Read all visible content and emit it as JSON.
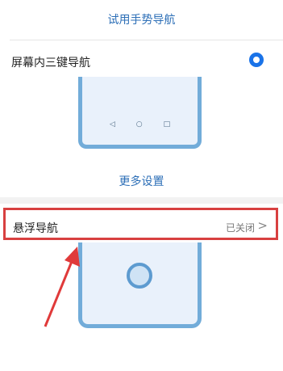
{
  "gesture_link": "试用手势导航",
  "three_key_nav": {
    "label": "屏幕内三键导航",
    "selected": true
  },
  "nav_icons": {
    "back": "◁",
    "home": "○",
    "recent": "□"
  },
  "more_settings": "更多设置",
  "floating_nav": {
    "label": "悬浮导航",
    "status": "已关闭",
    "chevron": ">"
  },
  "colors": {
    "accent": "#2d6fb7",
    "radio": "#1a73e8",
    "highlight": "#d84040",
    "illustration": "#72acd9"
  }
}
